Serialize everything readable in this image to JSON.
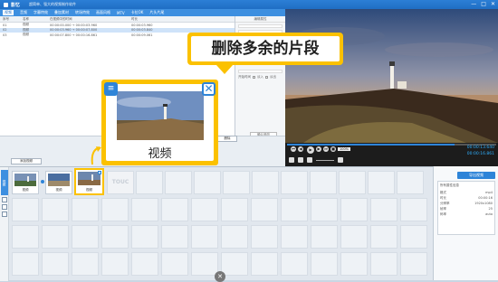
{
  "window": {
    "app_name": "影忆",
    "app_subtitle": "超简单、强大的视频制作软件",
    "min": "—",
    "max": "□",
    "close": "✕"
  },
  "menu": [
    {
      "label": "视频",
      "active": true
    },
    {
      "label": "音频"
    },
    {
      "label": "字幕特效"
    },
    {
      "label": "叠加素材"
    },
    {
      "label": "转场特效"
    },
    {
      "label": "画面风格"
    },
    {
      "label": "MTV"
    },
    {
      "label": "卡拉OK"
    },
    {
      "label": "片头片尾"
    }
  ],
  "list": {
    "headers": [
      "序号",
      "名称",
      "在视频中的时间",
      "时长"
    ],
    "rows": [
      {
        "no": "01",
        "name": "视频",
        "time": "00:00:00.000 → 00:00:03.960",
        "dur": "00:00:03.960",
        "selected": false
      },
      {
        "no": "02",
        "name": "视频",
        "time": "00:00:03.960 → 00:00:07.800",
        "dur": "00:00:03.840",
        "selected": true
      },
      {
        "no": "03",
        "name": "视频",
        "time": "00:00:07.800 → 00:00:16.861",
        "dur": "00:00:09.061",
        "selected": false
      }
    ]
  },
  "props": {
    "header": "编辑属性",
    "field_label": "开始时间",
    "checkbox1": "淡入",
    "checkbox2": "淡出",
    "apply_button": "确认修改"
  },
  "toolbar": {
    "add_button": "添加视频",
    "delete_button": "删除"
  },
  "player": {
    "time_current": "00:00:13.640",
    "time_total": "00:00:16.861",
    "zoom": "100%"
  },
  "timeline": {
    "side_label": "视频",
    "clips": [
      {
        "label": "视频"
      },
      {
        "label": "视频"
      },
      {
        "label": "视频"
      }
    ],
    "placeholder": "TOUC"
  },
  "info": {
    "export_button": "导出视频",
    "title": "所有属性信息",
    "lines": [
      {
        "k": "格式",
        "v": "mp4"
      },
      {
        "k": "时长",
        "v": "00:00:16"
      },
      {
        "k": "分辨率",
        "v": "1920x1080"
      },
      {
        "k": "帧率",
        "v": "25"
      },
      {
        "k": "码率",
        "v": "auto"
      }
    ]
  },
  "callout": {
    "text": "删除多余的片段"
  },
  "magnified": {
    "label": "视频"
  }
}
